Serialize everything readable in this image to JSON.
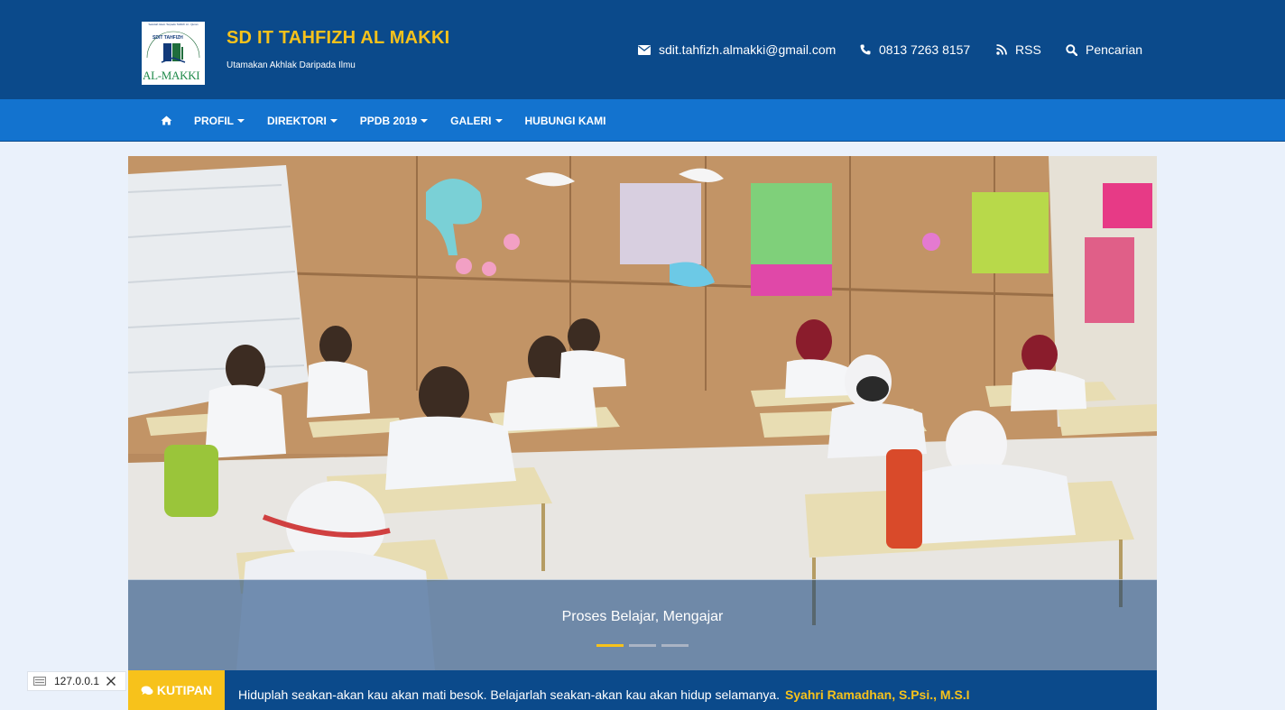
{
  "header": {
    "title": "SD IT TAHFIZH AL MAKKI",
    "tagline": "Utamakan Akhlak Daripada Ilmu",
    "logo": {
      "text_top": "SDIT TAHFIZH",
      "text_main": "AL-MAKKI",
      "text_arc": "Sekolah Islam Terpadu Tahfizh Al - Quran"
    },
    "contacts": [
      {
        "icon": "envelope-icon",
        "text": "sdit.tahfizh.almakki@gmail.com"
      },
      {
        "icon": "phone-icon",
        "text": "0813 7263 8157"
      },
      {
        "icon": "rss-icon",
        "text": "RSS"
      },
      {
        "icon": "search-icon",
        "text": "Pencarian"
      }
    ]
  },
  "nav": {
    "home_icon": "home-icon",
    "items": [
      {
        "label": "PROFIL",
        "dropdown": true
      },
      {
        "label": "DIREKTORI",
        "dropdown": true
      },
      {
        "label": "PPDB 2019",
        "dropdown": true
      },
      {
        "label": "GALERI",
        "dropdown": true
      },
      {
        "label": "HUBUNGI KAMI",
        "dropdown": false
      }
    ]
  },
  "slider": {
    "caption": "Proses Belajar, Mengajar",
    "slide_count": 3,
    "active_index": 0
  },
  "quote": {
    "label": "KUTIPAN",
    "text": "Hiduplah seakan-akan kau akan mati besok. Belajarlah seakan-akan kau akan hidup selamanya.",
    "author": "Syahri Ramadhan, S.Psi., M.S.I"
  },
  "ip_badge": {
    "text": "127.0.0.1"
  },
  "colors": {
    "header_bg": "#0b4a8b",
    "nav_bg": "#1373cf",
    "accent": "#f7c21b",
    "page_bg": "#eaf1fb"
  }
}
